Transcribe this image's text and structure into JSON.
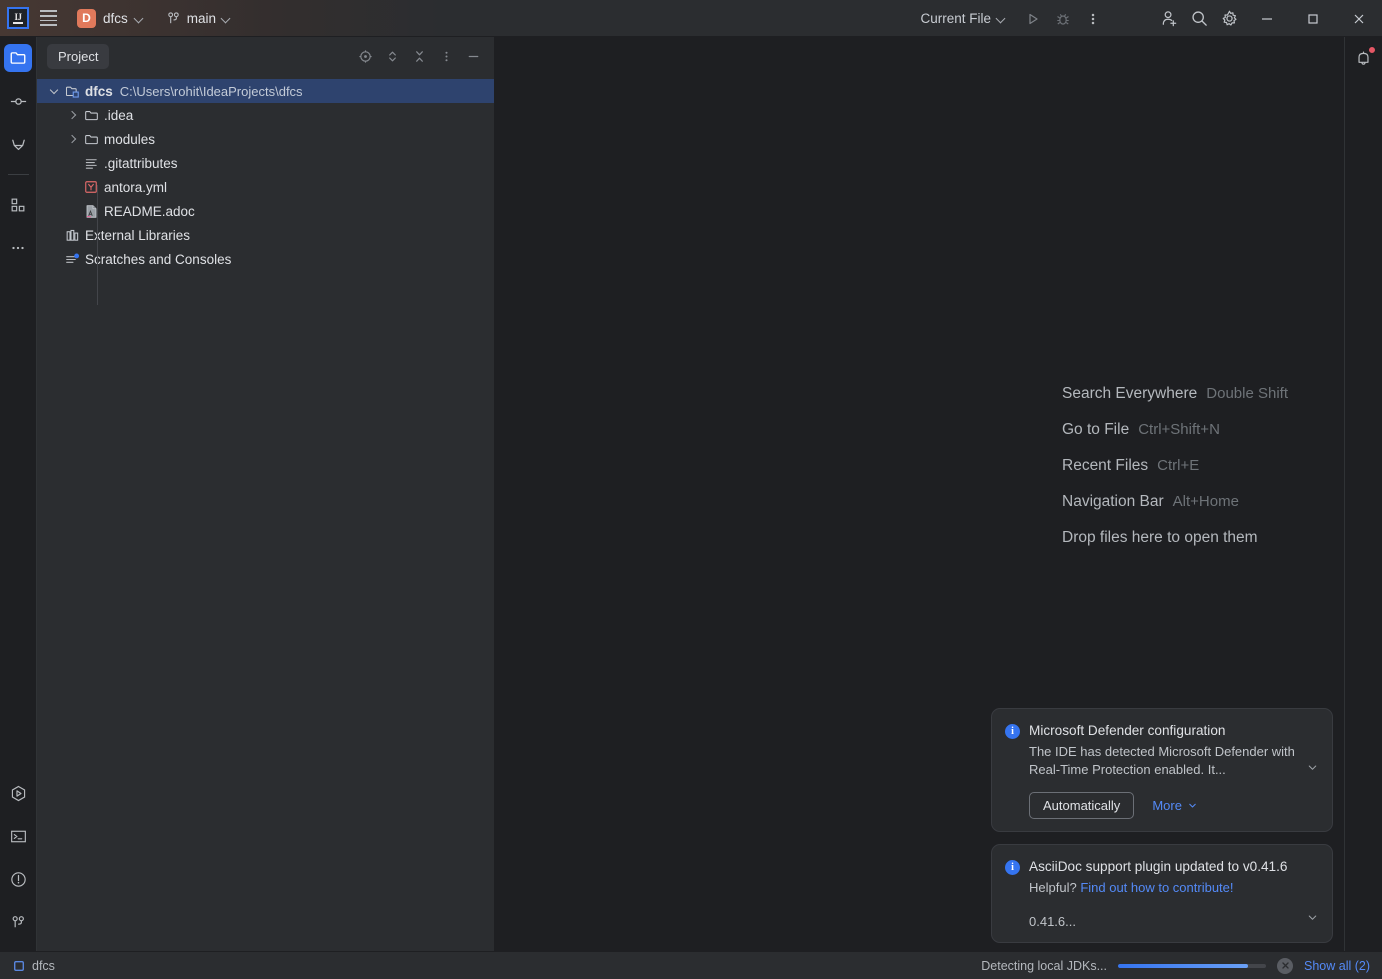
{
  "titlebar": {
    "logo_name": "intellij-idea-logo",
    "menu_label": "main-menu",
    "project_badge": "D",
    "project_name": "dfcs",
    "branch_name": "main",
    "run_config": "Current File",
    "icons": {
      "run": "run-icon",
      "debug": "debug-icon",
      "more": "more-vertical-icon",
      "collaborate": "add-user-icon",
      "search": "search-icon",
      "settings": "gear-icon",
      "minimize": "minimize-icon",
      "maximize": "maximize-icon",
      "close": "close-icon"
    }
  },
  "left_toolbar": {
    "top": [
      {
        "name": "project-tool-button",
        "icon": "folder-icon",
        "active": true
      },
      {
        "name": "commit-tool-button",
        "icon": "commit-icon",
        "active": false
      },
      {
        "name": "gitlab-tool-button",
        "icon": "gitlab-icon",
        "active": false
      },
      {
        "name": "structure-tool-button",
        "icon": "structure-grid-icon",
        "active": false
      },
      {
        "name": "more-tool-windows-button",
        "icon": "more-horizontal-icon",
        "active": false
      }
    ],
    "bottom": [
      {
        "name": "run-tool-button",
        "icon": "run-hexagon-icon"
      },
      {
        "name": "terminal-tool-button",
        "icon": "terminal-icon"
      },
      {
        "name": "problems-tool-button",
        "icon": "warning-circle-icon"
      },
      {
        "name": "git-tool-button",
        "icon": "git-branch-icon"
      }
    ]
  },
  "right_toolbar": {
    "notifications": {
      "name": "notifications-button",
      "icon": "bell-icon",
      "has_badge": true
    }
  },
  "panel": {
    "tab_label": "Project",
    "tools": [
      {
        "name": "select-opened-file-button",
        "icon": "target-icon"
      },
      {
        "name": "expand-all-button",
        "icon": "expand-chevrons-icon"
      },
      {
        "name": "collapse-all-button",
        "icon": "collapse-arrows-icon"
      },
      {
        "name": "panel-options-button",
        "icon": "more-vertical-icon"
      },
      {
        "name": "hide-panel-button",
        "icon": "minus-icon"
      }
    ],
    "tree": [
      {
        "label": "dfcs",
        "path": "C:\\Users\\rohit\\IdeaProjects\\dfcs",
        "icon": "project-folder-icon",
        "depth": 0,
        "twisty": "down",
        "selected": true,
        "bold": true
      },
      {
        "label": ".idea",
        "path": "",
        "icon": "folder-icon",
        "depth": 1,
        "twisty": "right",
        "selected": false,
        "bold": false
      },
      {
        "label": "modules",
        "path": "",
        "icon": "folder-icon",
        "depth": 1,
        "twisty": "right",
        "selected": false,
        "bold": false
      },
      {
        "label": ".gitattributes",
        "path": "",
        "icon": "text-file-icon",
        "depth": 1,
        "twisty": "none",
        "selected": false,
        "bold": false
      },
      {
        "label": "antora.yml",
        "path": "",
        "icon": "yaml-file-icon",
        "depth": 1,
        "twisty": "none",
        "selected": false,
        "bold": false
      },
      {
        "label": "README.adoc",
        "path": "",
        "icon": "asciidoc-file-icon",
        "depth": 1,
        "twisty": "none",
        "selected": false,
        "bold": false
      },
      {
        "label": "External Libraries",
        "path": "",
        "icon": "library-icon",
        "depth": 0,
        "twisty": "none",
        "selected": false,
        "bold": false
      },
      {
        "label": "Scratches and Consoles",
        "path": "",
        "icon": "scratches-icon",
        "depth": 0,
        "twisty": "none",
        "selected": false,
        "bold": false
      }
    ]
  },
  "editor": {
    "hints": [
      {
        "label": "Search Everywhere",
        "key": "Double Shift"
      },
      {
        "label": "Go to File",
        "key": "Ctrl+Shift+N"
      },
      {
        "label": "Recent Files",
        "key": "Ctrl+E"
      },
      {
        "label": "Navigation Bar",
        "key": "Alt+Home"
      }
    ],
    "drop_hint": "Drop files here to open them"
  },
  "notifications": [
    {
      "title": "Microsoft Defender configuration",
      "body": "The IDE has detected Microsoft Defender with Real-Time Protection enabled. It...",
      "primary_action": "Automatically",
      "secondary_action": "More"
    },
    {
      "title": "AsciiDoc support plugin updated to v0.41.6",
      "body_prefix": "Helpful? ",
      "body_link": "Find out how to contribute!",
      "version": "0.41.6..."
    }
  ],
  "statusbar": {
    "project_label": "dfcs",
    "task_text": "Detecting local JDKs...",
    "progress_percent": 88,
    "show_all_label": "Show all (2)"
  },
  "colors": {
    "accent_blue": "#3574f0",
    "link_blue": "#548af7",
    "selection_blue": "#2e436e",
    "project_badge": "#e0795b",
    "panel_bg": "#2b2d30",
    "editor_bg": "#1e1f22",
    "badge_red": "#e55765"
  }
}
